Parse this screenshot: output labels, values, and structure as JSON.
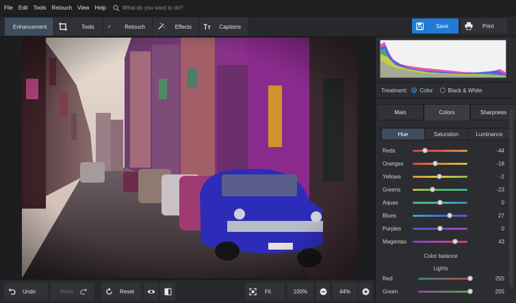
{
  "menu": {
    "items": [
      "File",
      "Edit",
      "Tools",
      "Retouch",
      "View",
      "Help"
    ],
    "search_placeholder": "What do you want to do?"
  },
  "toolbar": {
    "tabs": [
      {
        "label": "Enhancement",
        "icon": "sliders-icon",
        "active": true
      },
      {
        "label": "Tools",
        "icon": "crop-icon"
      },
      {
        "label": "Retouch",
        "icon": "brush-icon"
      },
      {
        "label": "Effects",
        "icon": "magic-wand-icon"
      },
      {
        "label": "Captions",
        "icon": "text-icon"
      }
    ],
    "save_label": "Save",
    "print_label": "Print"
  },
  "panel": {
    "treatment": {
      "label": "Treatment:",
      "color": "Color",
      "bw": "Black & White",
      "selected": "Color"
    },
    "tabs": [
      "Main",
      "Colors",
      "Sharpness"
    ],
    "active_tab": "Colors",
    "subtabs": [
      "Hue",
      "Saturation",
      "Luminance"
    ],
    "active_subtab": "Hue",
    "hue_sliders": [
      {
        "name": "Reds",
        "value": "-44"
      },
      {
        "name": "Oranges",
        "value": "-18"
      },
      {
        "name": "Yellows",
        "value": "-2"
      },
      {
        "name": "Greens",
        "value": "-23"
      },
      {
        "name": "Aquas",
        "value": "0"
      },
      {
        "name": "Blues",
        "value": "27"
      },
      {
        "name": "Purples",
        "value": "0"
      },
      {
        "name": "Magentas",
        "value": "43"
      }
    ],
    "color_balance_label": "Color balance",
    "lights_label": "Lights",
    "balance": [
      {
        "name": "Red",
        "value": "255"
      },
      {
        "name": "Green",
        "value": "255"
      }
    ]
  },
  "bottom": {
    "undo": "Undo",
    "redo": "Redo",
    "reset": "Reset",
    "fit": "Fit",
    "zoom_100": "100%",
    "zoom_current": "44%"
  },
  "colors": {
    "accent": "#1f7bd6",
    "active_tab": "#3e4c5e"
  }
}
